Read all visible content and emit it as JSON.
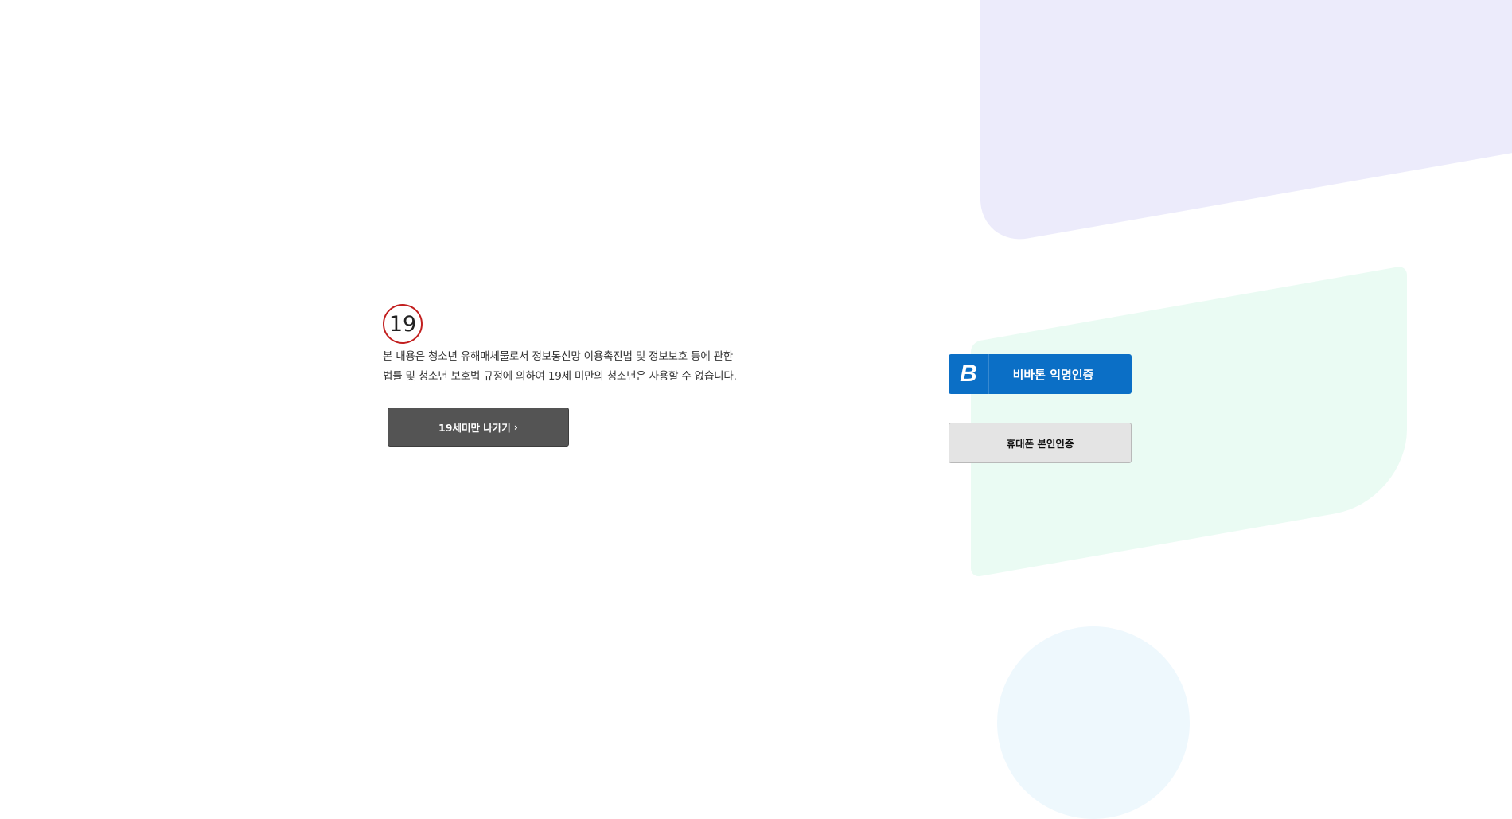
{
  "age_badge": "19",
  "notice": {
    "text": "본 내용은 청소년 유해매체물로서 정보통신망 이용촉진법 및 정보보호 등에 관한 법률 및 청소년 보호법 규정에 의하여 19세 미만의 청소년은 사용할 수 없습니다."
  },
  "exit_button": {
    "label": "19세미만 나가기",
    "chevron": "›"
  },
  "auth": {
    "vivaton_logo": "B",
    "vivaton_label": "비바톤 익명인증",
    "phone_label": "휴대폰 본인인증"
  },
  "colors": {
    "badge_border": "#c21f1f",
    "exit_button_bg": "#545454",
    "vivaton_bg": "#0b6fc6",
    "phone_button_bg": "#e4e4e4",
    "bg_purple": "#ecebfb",
    "bg_green": "#eafbf3",
    "bg_circle": "#eef8fd"
  }
}
